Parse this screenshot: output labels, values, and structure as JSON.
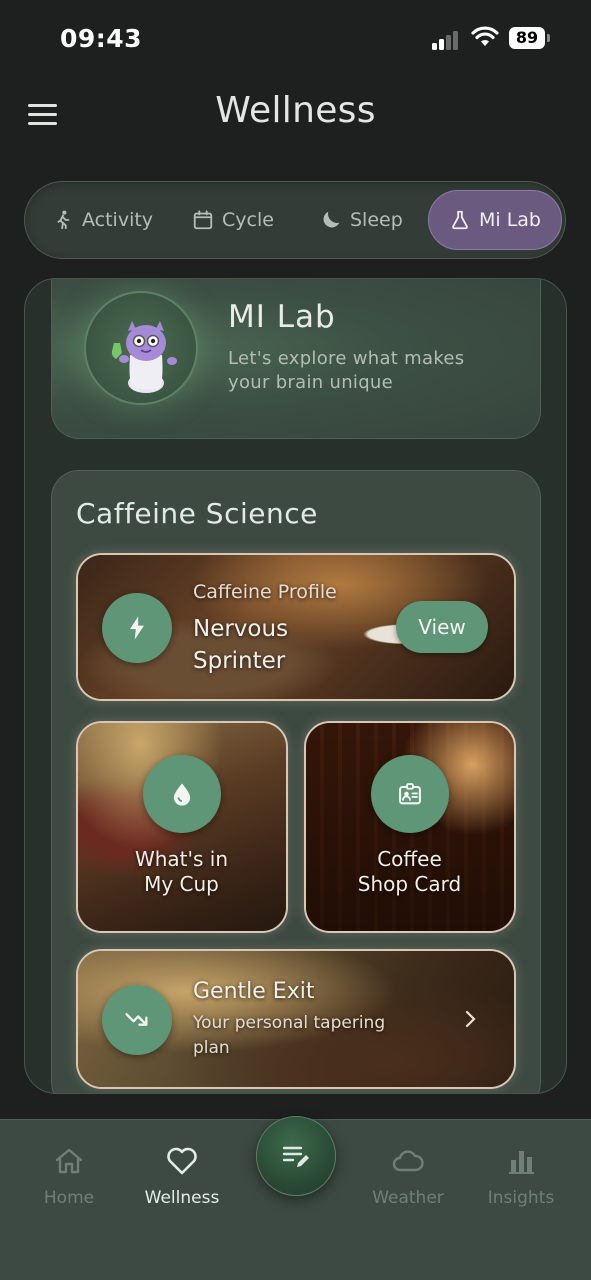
{
  "status_bar": {
    "time": "09:43",
    "battery": "89"
  },
  "header": {
    "title": "Wellness"
  },
  "tabs": [
    {
      "label": "Activity",
      "icon": "walking-icon",
      "active": false
    },
    {
      "label": "Cycle",
      "icon": "calendar-icon",
      "active": false
    },
    {
      "label": "Sleep",
      "icon": "moon-icon",
      "active": false
    },
    {
      "label": "Mi Lab",
      "icon": "flask-icon",
      "active": true
    }
  ],
  "hero": {
    "title": "MI Lab",
    "subtitle": "Let's explore what makes your brain unique"
  },
  "science": {
    "title": "Caffeine Science",
    "profile": {
      "label": "Caffeine Profile",
      "value_line1": "Nervous",
      "value_line2": "Sprinter",
      "button": "View"
    },
    "cup": {
      "line1": "What's in",
      "line2": "My Cup"
    },
    "shop": {
      "line1": "Coffee",
      "line2": "Shop Card"
    },
    "exit": {
      "title": "Gentle Exit",
      "subtitle_line1": "Your personal tapering",
      "subtitle_line2": "plan"
    }
  },
  "bottom_nav": [
    {
      "label": "Home",
      "icon": "home-icon",
      "active": false
    },
    {
      "label": "Wellness",
      "icon": "heart-icon",
      "active": true
    },
    {
      "label": "Weather",
      "icon": "cloud-icon",
      "active": false
    },
    {
      "label": "Insights",
      "icon": "bar-chart-icon",
      "active": false
    }
  ],
  "colors": {
    "background": "#1e2020",
    "accent_green": "#5f9677",
    "tab_active": "#6a5a80"
  }
}
